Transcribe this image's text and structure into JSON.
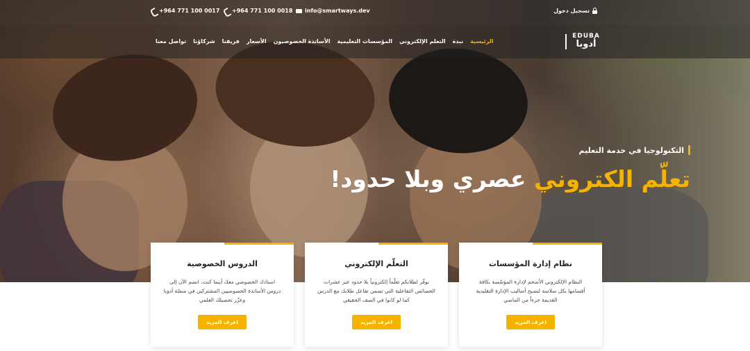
{
  "topbar": {
    "login": "تسجيل دخول",
    "email": "info@smartways.dev",
    "phone1": "+964 771 100 0018",
    "phone2": "+964 771 100 0017"
  },
  "logo": {
    "en": "EDUBA",
    "ar": "أدوبا"
  },
  "nav": {
    "items": [
      {
        "label": "الرئيسية",
        "active": true
      },
      {
        "label": "نبذة"
      },
      {
        "label": "التعلم الإلكتروني"
      },
      {
        "label": "المؤسسات التعليمية"
      },
      {
        "label": "الأساتذة الخصوصيون"
      },
      {
        "label": "الأسعار"
      },
      {
        "label": "فريقنا"
      },
      {
        "label": "شركاؤنا"
      },
      {
        "label": "تواصل معنا"
      }
    ]
  },
  "hero": {
    "tagline": "التكنولوجيا في خدمة التعليم",
    "headline_highlight": "تعلّم الكتروني",
    "headline_rest": " عصري وبلا حدود!"
  },
  "cards": [
    {
      "title": "نظام إدارة المؤسسات",
      "text": "النظام الإلكتروني الأضخم لإدارة المؤسّسة بكافة أقسامها بكل سلاسة لتصبح أساليب الإدارة التقليدية القديمة جزءاً من الماضي",
      "button": "اعرف المزيد"
    },
    {
      "title": "التعلّم الإلكتروني",
      "text": "نوفّر لطلابكم تعلّماً إلكترونياً بلا حدود عبر عشرات الخصائص التفاعلية التي تضمن تفاعل طلابك مع الدرس كما لو كانوا في الصف الحقيقي",
      "button": "اعرف المزيد"
    },
    {
      "title": "الدروس الخصوصية",
      "text": "استاذك الخصوصي معك أينما كنت. انضم الآن إلى دروس الأساتذة الخصوصيين المشتركين في منصّة أدوبا وعزّز تحصيلك العلمي",
      "button": "اعرف المزيد"
    }
  ],
  "colors": {
    "accent": "#f5b300"
  }
}
